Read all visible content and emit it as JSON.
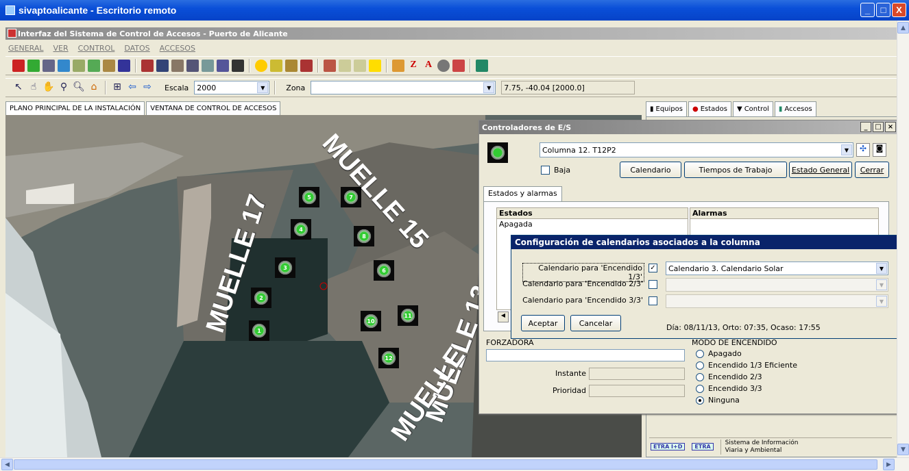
{
  "window": {
    "title": "sivaptoalicante - Escritorio remoto",
    "min": "_",
    "max": "□",
    "close": "X"
  },
  "app": {
    "title": "Interfaz del Sistema de Control de Accesos - Puerto de Alicante"
  },
  "menu": [
    "GENERAL",
    "VER",
    "CONTROL",
    "DATOS",
    "ACCESOS"
  ],
  "toolbar2": {
    "escala_label": "Escala",
    "escala_value": "2000",
    "zona_label": "Zona",
    "zona_value": "",
    "coords": "7.75, -40.04 [2000.0]"
  },
  "map_tabs": [
    "PLANO PRINCIPAL DE LA INSTALACIÓN",
    "VENTANA DE CONTROL DE ACCESOS"
  ],
  "map": {
    "labels": [
      "MUELLE 17",
      "MUELLE 15",
      "MUELLE 13",
      "MUELLE"
    ],
    "lights": [
      "1",
      "2",
      "3",
      "4",
      "5",
      "6",
      "7",
      "8",
      "9",
      "10",
      "11",
      "12"
    ]
  },
  "right_tabs": [
    "Equipos",
    "Estados",
    "Control",
    "Accesos"
  ],
  "ctrl": {
    "title": "Controladores de E/S",
    "device": "Columna 12. T12P2",
    "baja_label": "Baja",
    "btn_calendario": "Calendario",
    "btn_tiempos": "Tiempos de Trabajo",
    "btn_estado": "Estado General",
    "btn_cerrar": "Cerrar",
    "tab": "Estados y alarmas",
    "col_estados": "Estados",
    "col_alarmas": "Alarmas",
    "estado_value": "Apagada",
    "forzadora": "FORZADORA",
    "modo": "MODO DE ENCENDIDO",
    "instante": "Instante",
    "prioridad": "Prioridad",
    "modos": [
      "Apagado",
      "Encendido 1/3 Eficiente",
      "Encendido 2/3",
      "Encendido 3/3",
      "Ninguna"
    ],
    "modo_selected": "Ninguna"
  },
  "dialog": {
    "title": "Configuración de calendarios asociados a la columna",
    "rows": [
      {
        "label": "Calendario para 'Encendido 1/3'",
        "checked": "✓",
        "value": "Calendario 3. Calendario Solar"
      },
      {
        "label": "Calendario para 'Encendido 2/3'",
        "checked": "",
        "value": ""
      },
      {
        "label": "Calendario para 'Encendido 3/3'",
        "checked": "",
        "value": ""
      }
    ],
    "aceptar": "Aceptar",
    "cancelar": "Cancelar",
    "info": "Día: 08/11/13, Orto: 07:35, Ocaso: 17:55"
  },
  "footer": {
    "etra1": "ETRA I+D",
    "etra2": "ETRA",
    "sistema": "Sistema de Información Viaria y Ambiental"
  }
}
